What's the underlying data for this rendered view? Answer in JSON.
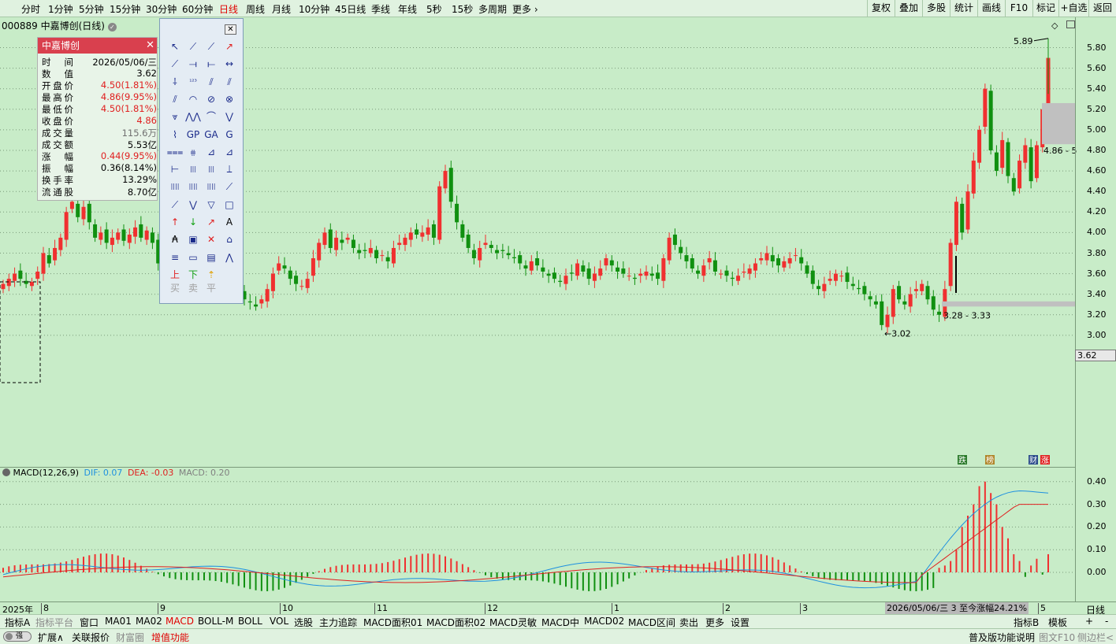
{
  "toolbar": {
    "periods": [
      "分时",
      "1分钟",
      "5分钟",
      "15分钟",
      "30分钟",
      "60分钟",
      "日线",
      "周线",
      "月线",
      "10分钟",
      "45日线",
      "季线",
      "年线",
      "5秒",
      "15秒",
      "多周期",
      "更多"
    ],
    "active_period": "日线",
    "right": [
      "复权",
      "叠加",
      "多股",
      "统计",
      "画线",
      "F10",
      "标记",
      "+自选",
      "返回"
    ]
  },
  "stock": {
    "title": "000889 中嘉博创(日线)"
  },
  "info_panel": {
    "title": "中嘉博创",
    "rows": [
      {
        "k": "时间",
        "v": "2026/05/06/三",
        "color": "#000"
      },
      {
        "k": "数值",
        "v": "3.62",
        "color": "#000"
      },
      {
        "k": "开盘价",
        "v": "4.50(1.81%)",
        "color": "#e02020"
      },
      {
        "k": "最高价",
        "v": "4.86(9.95%)",
        "color": "#e02020"
      },
      {
        "k": "最低价",
        "v": "4.50(1.81%)",
        "color": "#e02020"
      },
      {
        "k": "收盘价",
        "v": "4.86",
        "color": "#e02020"
      },
      {
        "k": "成交量",
        "v": "115.6万",
        "color": "#707070"
      },
      {
        "k": "成交额",
        "v": "5.53亿",
        "color": "#000"
      },
      {
        "k": "涨幅",
        "v": "0.44(9.95%)",
        "color": "#e02020"
      },
      {
        "k": "振幅",
        "v": "0.36(8.14%)",
        "color": "#000"
      },
      {
        "k": "换手率",
        "v": "13.29%",
        "color": "#000"
      },
      {
        "k": "流通股",
        "v": "8.70亿",
        "color": "#000"
      }
    ]
  },
  "drawing_tools": {
    "text_tools": [
      "A",
      "₳",
      "上",
      "下",
      "平",
      "买",
      "卖",
      "平"
    ]
  },
  "price_axis": {
    "min": 3.0,
    "max": 5.8,
    "step": 0.2,
    "labels": [
      "5.80",
      "5.60",
      "5.40",
      "5.20",
      "5.00",
      "4.80",
      "4.60",
      "4.40",
      "4.20",
      "4.00",
      "3.80",
      "3.60",
      "3.40",
      "3.20",
      "3.00"
    ],
    "current": "3.62"
  },
  "annotations": {
    "high": "5.89",
    "low": "3.02",
    "range1": "3.28 - 3.33",
    "range2": "4.86 - 5",
    "markers": [
      "跌",
      "榜",
      "财",
      "涨"
    ]
  },
  "macd": {
    "title": "MACD(12,26,9)",
    "dif": "DIF: 0.07",
    "dea": "DEA: -0.03",
    "macd": "MACD: 0.20",
    "axis_labels": [
      "0.40",
      "0.30",
      "0.20",
      "0.10",
      "0.00"
    ]
  },
  "date_axis": {
    "labels": [
      "2025年",
      "8",
      "9",
      "10",
      "11",
      "12",
      "1",
      "2",
      "3",
      "5"
    ],
    "cursor_info": "2026/05/06/三 3 至今涨幅24.21%",
    "right": "日线"
  },
  "tabs": {
    "items": [
      "指标A",
      "指标平台",
      "窗口",
      "MA01",
      "MA02",
      "MACD",
      "BOLL-M",
      "BOLL",
      "VOL",
      "选股",
      "主力追踪",
      "MACD面积01",
      "MACD面积02",
      "MACD灵敏",
      "MACD中",
      "MACD02",
      "MACD区间",
      "卖出",
      "更多",
      "设置"
    ],
    "active": "MACD",
    "right": [
      "指标B",
      "模板",
      "+",
      "-"
    ]
  },
  "status": {
    "left": [
      "扩展∧",
      "关联报价",
      "财富圈",
      "增值功能"
    ],
    "right": [
      "普及版功能说明",
      "图文F10",
      "侧边栏<"
    ]
  },
  "colors": {
    "up": "#f03030",
    "down": "#109010",
    "dif": "#1e90e0",
    "dea": "#e02020",
    "bg": "#c8ecc8"
  }
}
